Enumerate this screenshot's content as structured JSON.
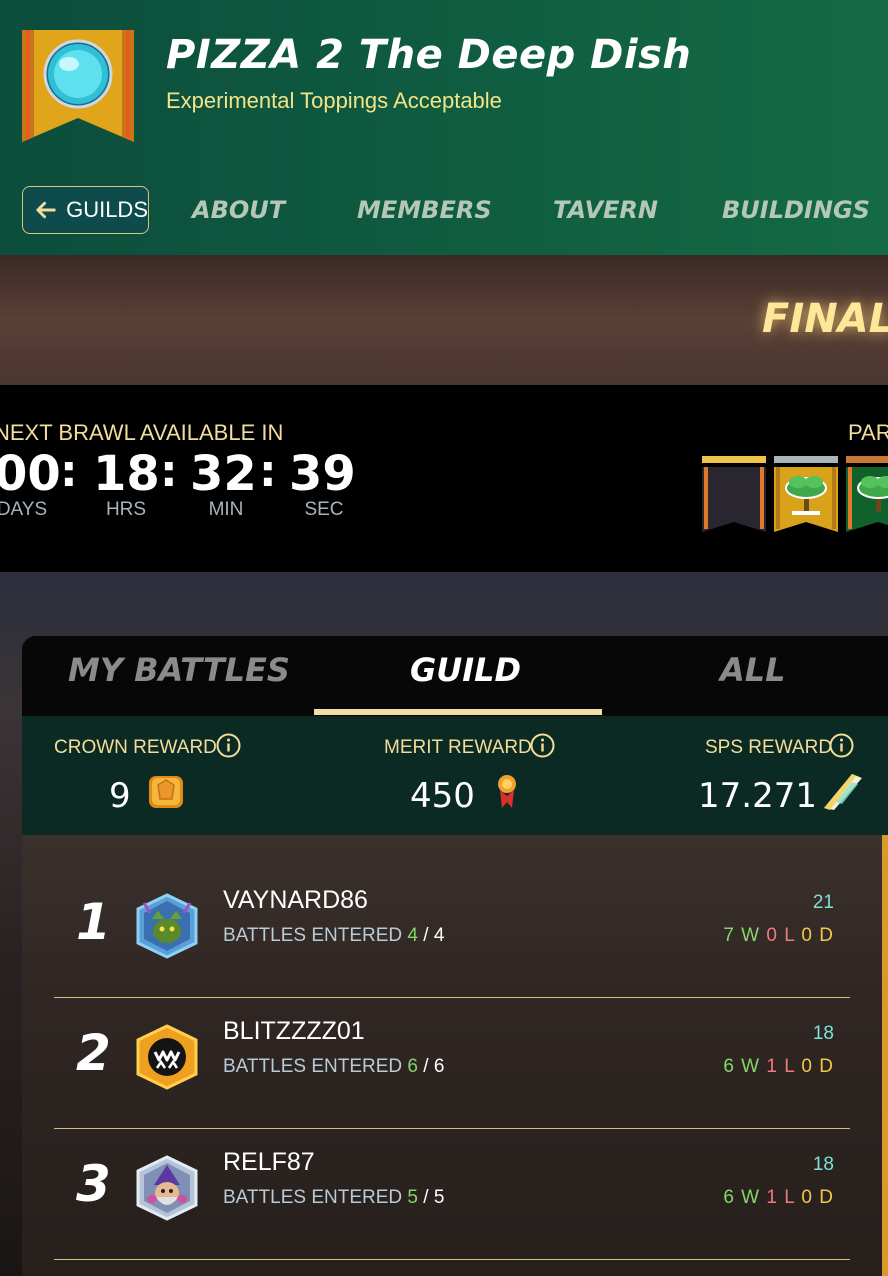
{
  "guild": {
    "name": "PIZZA 2 The Deep Dish",
    "motto": "Experimental Toppings Acceptable"
  },
  "nav": {
    "back_label": "GUILDS",
    "tabs": [
      "ABOUT",
      "MEMBERS",
      "TAVERN",
      "BUILDINGS"
    ]
  },
  "hero": {
    "title": "FINAL"
  },
  "countdown": {
    "label": "NEXT BRAWL AVAILABLE IN",
    "days": "00",
    "hrs": "18",
    "min": "32",
    "sec": "39",
    "units": {
      "days": "DAYS",
      "hrs": "HRS",
      "min": "MIN",
      "sec": "SEC"
    },
    "separator": ":"
  },
  "participants": {
    "label": "PAR",
    "flags": [
      {
        "bar_color": "#f0c34a",
        "flag_color": "#2a2630",
        "icon": "empty-flag-icon"
      },
      {
        "bar_color": "#a9b7bd",
        "flag_color": "#d9a21b",
        "icon": "tree-icon"
      },
      {
        "bar_color": "#c87a34",
        "flag_color": "#11612d",
        "icon": "tree-icon"
      }
    ]
  },
  "battle_tabs": {
    "items": [
      "MY BATTLES",
      "GUILD",
      "ALL"
    ],
    "active": "GUILD"
  },
  "rewards": {
    "crown": {
      "label": "CROWN REWARD",
      "value": "9",
      "icon": "crown-token-icon"
    },
    "merit": {
      "label": "MERIT REWARD",
      "value": "450",
      "icon": "merit-medal-icon"
    },
    "sps": {
      "label": "SPS REWARD",
      "value": "17.271",
      "icon": "sps-crystal-icon"
    }
  },
  "members": [
    {
      "rank": "1",
      "name": "VAYNARD86",
      "battles_label": "BATTLES ENTERED",
      "entered": "4",
      "total": "4",
      "score": "21",
      "w": "7",
      "l": "0",
      "d": "0",
      "avatar": "goblin-avatar-icon"
    },
    {
      "rank": "2",
      "name": "BLITZZZZ01",
      "battles_label": "BATTLES ENTERED",
      "entered": "6",
      "total": "6",
      "score": "18",
      "w": "6",
      "l": "1",
      "d": "0",
      "avatar": "monster-mouth-avatar-icon"
    },
    {
      "rank": "3",
      "name": "RELF87",
      "battles_label": "BATTLES ENTERED",
      "entered": "5",
      "total": "5",
      "score": "18",
      "w": "6",
      "l": "1",
      "d": "0",
      "avatar": "wizard-avatar-icon"
    }
  ],
  "wld_letters": {
    "w": "W",
    "l": "L",
    "d": "D"
  },
  "colors": {
    "header_green": "#0f5a40",
    "accent_gold": "#f3dd9a",
    "win": "#84d66a",
    "loss": "#f07b7b",
    "draw": "#f3c84a",
    "score": "#7fe0d8"
  }
}
